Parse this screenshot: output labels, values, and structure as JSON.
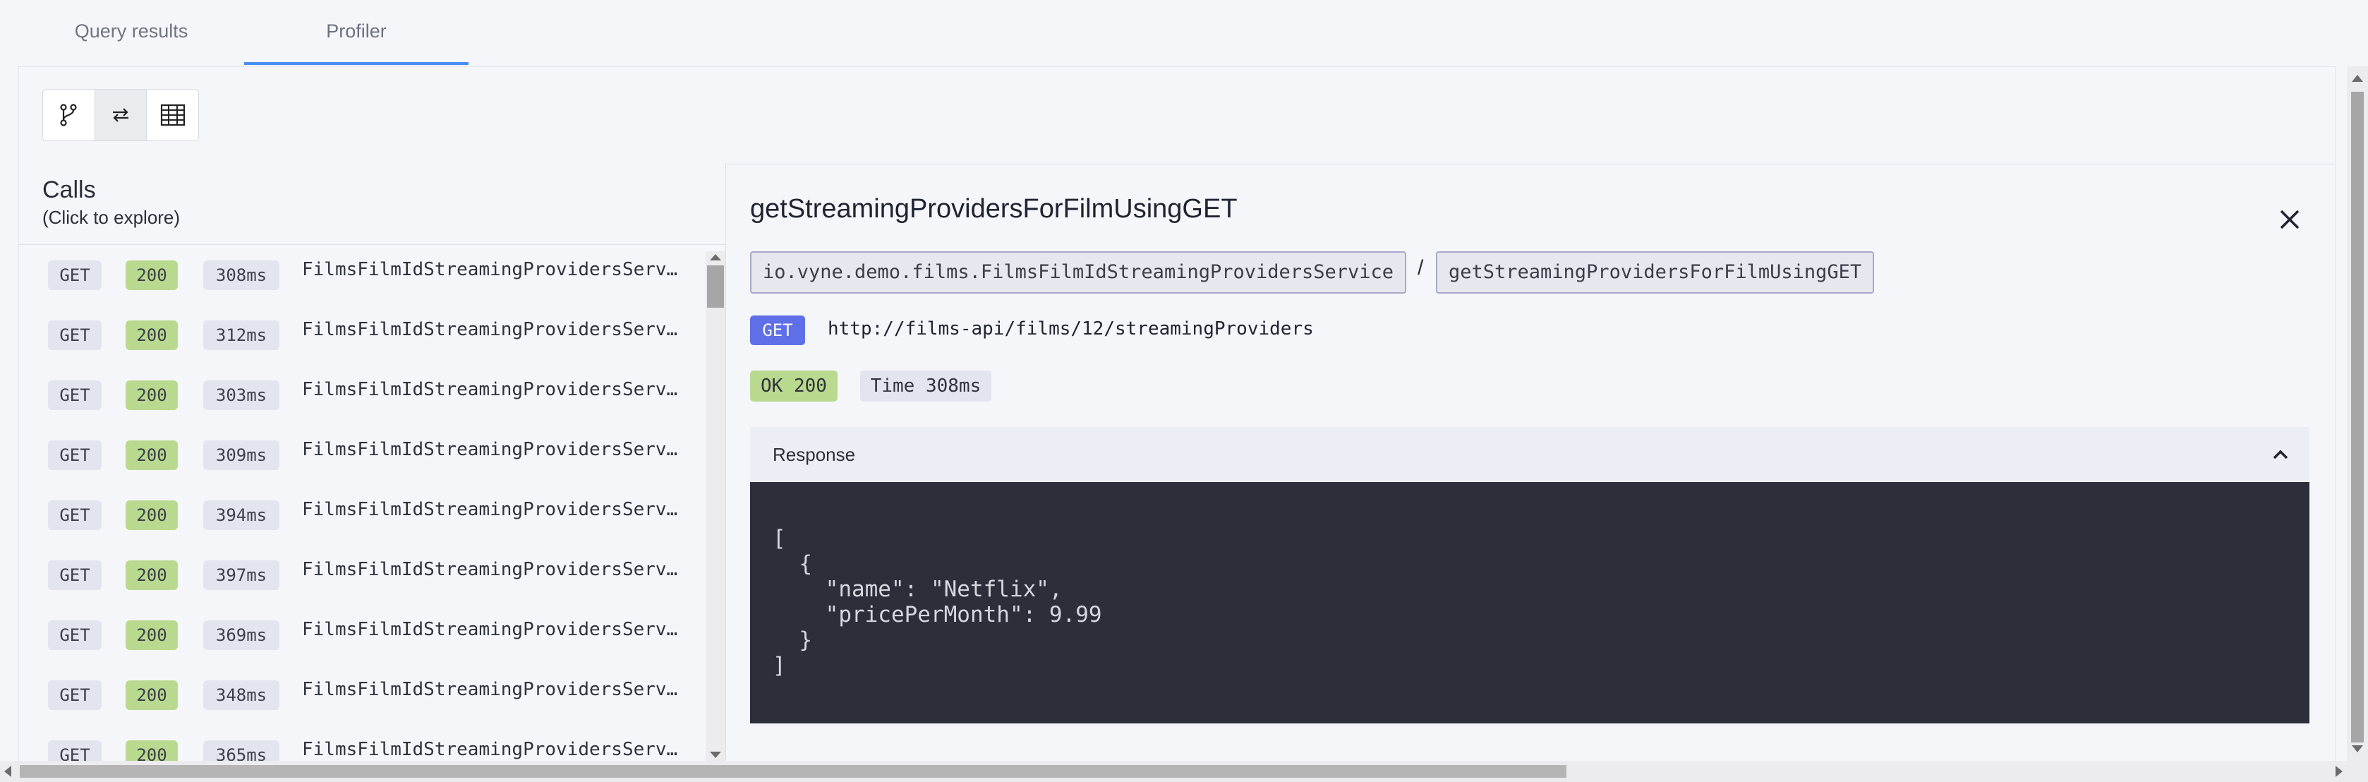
{
  "tabs": [
    {
      "label": "Query results"
    },
    {
      "label": "Profiler"
    }
  ],
  "view_toggle": {
    "options": [
      "graph-view-icon",
      "swap-view-icon",
      "table-view-icon"
    ],
    "selected": "swap-view-icon"
  },
  "calls": {
    "title": "Calls",
    "subtitle": "(Click to explore)",
    "rows": [
      {
        "method": "GET",
        "status": "200",
        "time": "308ms",
        "operation": "FilmsFilmIdStreamingProvidersServ…"
      },
      {
        "method": "GET",
        "status": "200",
        "time": "312ms",
        "operation": "FilmsFilmIdStreamingProvidersServ…"
      },
      {
        "method": "GET",
        "status": "200",
        "time": "303ms",
        "operation": "FilmsFilmIdStreamingProvidersServ…"
      },
      {
        "method": "GET",
        "status": "200",
        "time": "309ms",
        "operation": "FilmsFilmIdStreamingProvidersServ…"
      },
      {
        "method": "GET",
        "status": "200",
        "time": "394ms",
        "operation": "FilmsFilmIdStreamingProvidersServ…"
      },
      {
        "method": "GET",
        "status": "200",
        "time": "397ms",
        "operation": "FilmsFilmIdStreamingProvidersServ…"
      },
      {
        "method": "GET",
        "status": "200",
        "time": "369ms",
        "operation": "FilmsFilmIdStreamingProvidersServ…"
      },
      {
        "method": "GET",
        "status": "200",
        "time": "348ms",
        "operation": "FilmsFilmIdStreamingProvidersServ…"
      },
      {
        "method": "GET",
        "status": "200",
        "time": "365ms",
        "operation": "FilmsFilmIdStreamingProvidersServ…"
      }
    ]
  },
  "detail": {
    "title": "getStreamingProvidersForFilmUsingGET",
    "service": "io.vyne.demo.films.FilmsFilmIdStreamingProvidersService",
    "separator": "/",
    "operation": "getStreamingProvidersForFilmUsingGET",
    "method": "GET",
    "url": "http://films-api/films/12/streamingProviders",
    "status": "OK 200",
    "time": "Time 308ms",
    "response_label": "Response",
    "response_body": "[\n  {\n    \"name\": \"Netflix\",\n    \"pricePerMonth\": 9.99\n  }\n]"
  },
  "colors": {
    "accent": "#4a8cf0",
    "method_tag": "#5f6fe8",
    "status_ok": "#b9d98f",
    "code_bg": "#2c2f3a"
  }
}
